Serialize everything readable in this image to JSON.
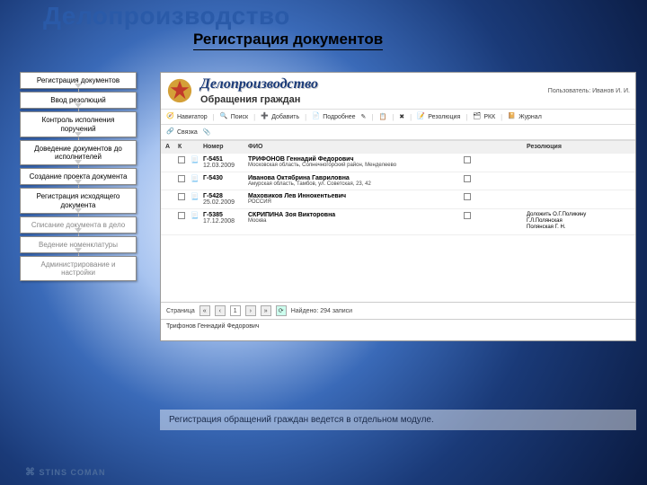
{
  "page": {
    "main_title": "Делопроизводство",
    "sub_title": "Регистрация документов",
    "caption": "Регистрация обращений граждан ведется в отдельном модуле.",
    "logo": "STINS COMAN"
  },
  "sidebar": {
    "items": [
      {
        "label": "Регистрация документов"
      },
      {
        "label": "Ввод резолюций"
      },
      {
        "label": "Контроль исполнения поручений"
      },
      {
        "label": "Доведение документов до исполнителей"
      },
      {
        "label": "Создание проекта документа"
      },
      {
        "label": "Регистрация исходящего документа"
      },
      {
        "label": "Списание документа в дело"
      },
      {
        "label": "Ведение номенклатуры"
      },
      {
        "label": "Администрирование и настройки"
      }
    ]
  },
  "app": {
    "title": "Делопроизводство",
    "section": "Обращения граждан",
    "user_prefix": "Пользователь:",
    "user_name": "Иванов И. И.",
    "toolbar": {
      "navigator": "Навигатор",
      "search": "Поиск",
      "add": "Добавить",
      "details": "Подробнее",
      "resolution": "Резолюция",
      "rkk": "РКК",
      "journal": "Журнал",
      "link": "Связка"
    },
    "columns": {
      "a": "А",
      "k": "К",
      "blank": "",
      "num": "Номер",
      "fio": "ФИО",
      "res": "Резолюция"
    },
    "rows": [
      {
        "num": "Г-5451",
        "date": "12.03.2009",
        "name": "ТРИФОНОВ Геннадий Федорович",
        "addr": "Московская область, Солнечногорский район, Менделеево",
        "res": ""
      },
      {
        "num": "Г-5430",
        "date": "",
        "name": "Иванова Октябрина Гавриловна",
        "addr": "Амурская область, Тамбов, ул. Советская, 23, 42",
        "res": ""
      },
      {
        "num": "Г-5428",
        "date": "25.02.2009",
        "name": "Маховиков Лев Иннокентьевич",
        "addr": "РОССИЯ",
        "res": ""
      },
      {
        "num": "Г-5385",
        "date": "17.12.2008",
        "name": "СКРИПИНА Зоя Викторовна",
        "addr": "Москва",
        "res": "Доложить О.Г.Поликину"
      }
    ],
    "extra_res": "Г.Л.Полянская\nПолянская Г. Н.",
    "status": {
      "page_label": "Страница",
      "page": "1",
      "found": "Найдено: 294 записи"
    },
    "detail": "Трифонов Геннадий Федорович"
  }
}
